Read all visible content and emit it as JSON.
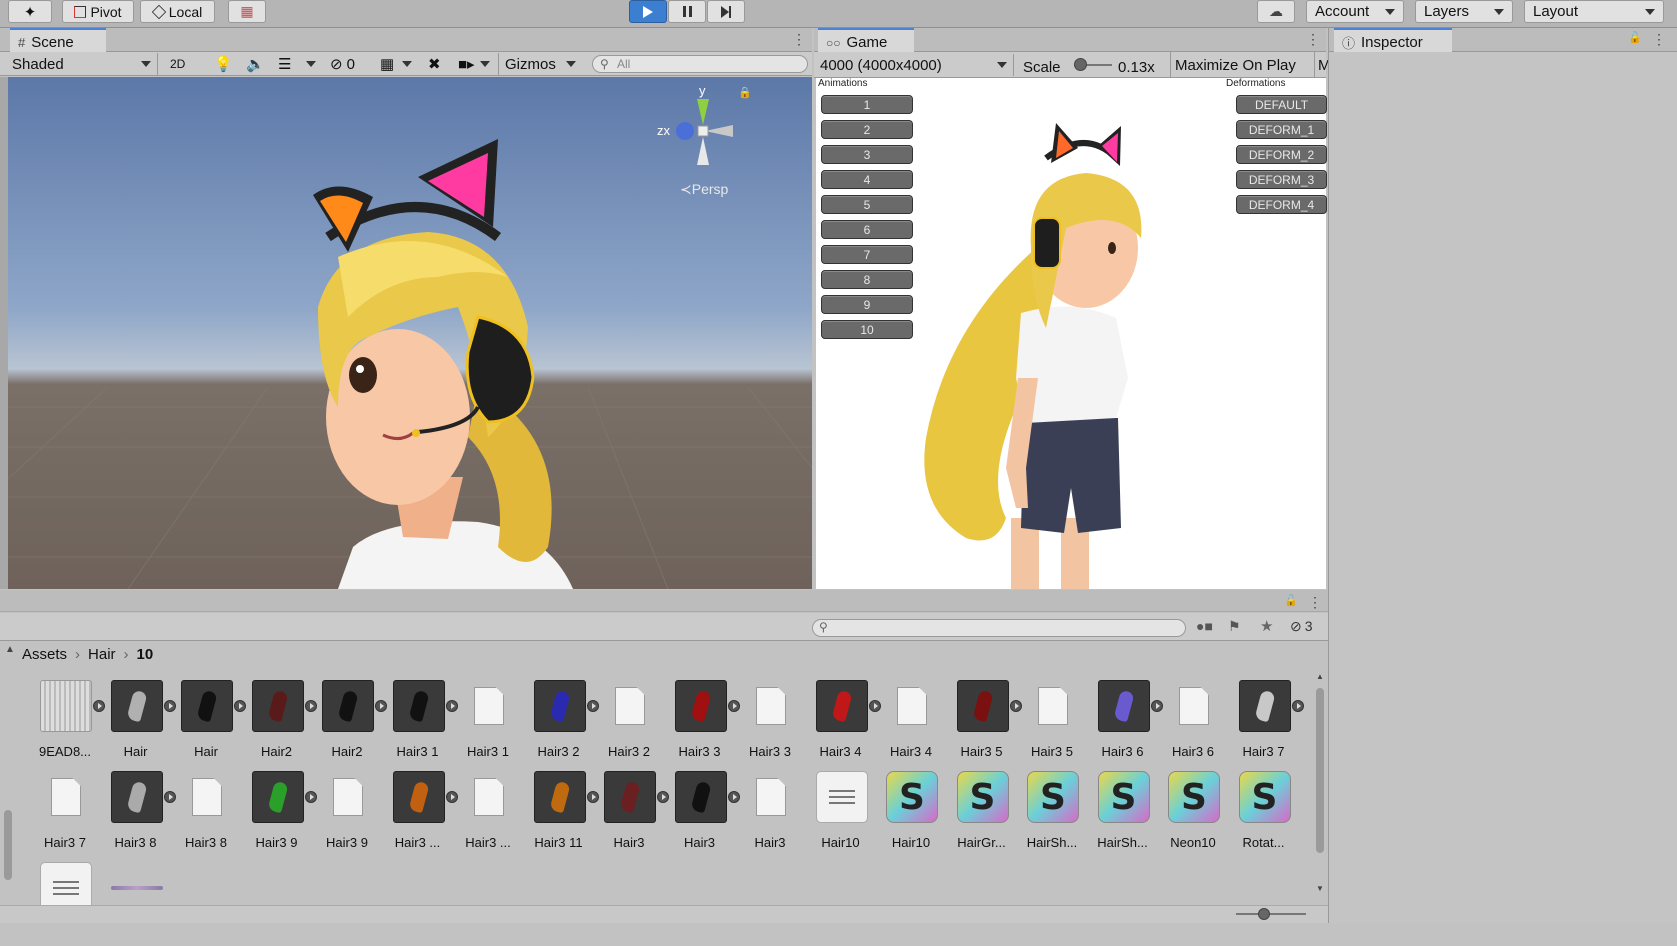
{
  "toolbar": {
    "pivot": "Pivot",
    "local": "Local",
    "account": "Account",
    "layers": "Layers",
    "layout": "Layout"
  },
  "scene": {
    "tab": "Scene",
    "shading": "Shaded",
    "mode_2d": "2D",
    "hidden_count": "0",
    "gizmos": "Gizmos",
    "search_placeholder": "All",
    "axis_y": "y",
    "axis_zx": "zx",
    "persp": "Persp"
  },
  "game": {
    "tab": "Game",
    "resolution": "4000 (4000x4000)",
    "scale_label": "Scale",
    "scale_value": "0.13x",
    "maximize": "Maximize On Play",
    "m_cut": "M",
    "animations_label": "Animations",
    "deformations_label": "Deformations",
    "animation_buttons": [
      "1",
      "2",
      "3",
      "4",
      "5",
      "6",
      "7",
      "8",
      "9",
      "10"
    ],
    "deform_buttons": [
      "DEFAULT",
      "DEFORM_1",
      "DEFORM_2",
      "DEFORM_3",
      "DEFORM_4"
    ]
  },
  "inspector": {
    "tab": "Inspector"
  },
  "project": {
    "breadcrumb": [
      "Assets",
      "Hair",
      "10"
    ],
    "hidden_count": "3",
    "assets": [
      {
        "label": "9EAD8...",
        "kind": "texture"
      },
      {
        "label": "Hair",
        "kind": "prefab",
        "color": "#b0b0b0"
      },
      {
        "label": "Hair",
        "kind": "prefab",
        "color": "#111111"
      },
      {
        "label": "Hair2",
        "kind": "prefab",
        "color": "#5a1a1a"
      },
      {
        "label": "Hair2",
        "kind": "prefab",
        "color": "#111111"
      },
      {
        "label": "Hair3 1",
        "kind": "prefab",
        "color": "#111111"
      },
      {
        "label": "Hair3 1",
        "kind": "file"
      },
      {
        "label": "Hair3 2",
        "kind": "prefab",
        "color": "#2a2ab0"
      },
      {
        "label": "Hair3 2",
        "kind": "file"
      },
      {
        "label": "Hair3 3",
        "kind": "prefab",
        "color": "#a01010"
      },
      {
        "label": "Hair3 3",
        "kind": "file"
      },
      {
        "label": "Hair3 4",
        "kind": "prefab",
        "color": "#c01818"
      },
      {
        "label": "Hair3 4",
        "kind": "file"
      },
      {
        "label": "Hair3 5",
        "kind": "prefab",
        "color": "#7a1010"
      },
      {
        "label": "Hair3 5",
        "kind": "file"
      },
      {
        "label": "Hair3 6",
        "kind": "prefab",
        "color": "#6a5ad0"
      },
      {
        "label": "Hair3 6",
        "kind": "file"
      },
      {
        "label": "Hair3 7",
        "kind": "prefab",
        "color": "#c8c8c8"
      },
      {
        "label": "Hair3 7",
        "kind": "file"
      },
      {
        "label": "Hair3 8",
        "kind": "prefab",
        "color": "#aaaaaa"
      },
      {
        "label": "Hair3 8",
        "kind": "file"
      },
      {
        "label": "Hair3 9",
        "kind": "prefab",
        "color": "#2aa02a"
      },
      {
        "label": "Hair3 9",
        "kind": "file"
      },
      {
        "label": "Hair3 ...",
        "kind": "prefab",
        "color": "#c06010"
      },
      {
        "label": "Hair3 ...",
        "kind": "file"
      },
      {
        "label": "Hair3 11",
        "kind": "prefab",
        "color": "#c06a10"
      },
      {
        "label": "Hair3",
        "kind": "prefab",
        "color": "#6a2020"
      },
      {
        "label": "Hair3",
        "kind": "prefab",
        "color": "#111111"
      },
      {
        "label": "Hair3",
        "kind": "file"
      },
      {
        "label": "Hair10",
        "kind": "text"
      },
      {
        "label": "Hair10",
        "kind": "shader"
      },
      {
        "label": "HairGr...",
        "kind": "shader"
      },
      {
        "label": "HairSh...",
        "kind": "shader"
      },
      {
        "label": "HairSh...",
        "kind": "shader"
      },
      {
        "label": "Neon10",
        "kind": "shader"
      },
      {
        "label": "Rotat...",
        "kind": "shader"
      },
      {
        "label": "",
        "kind": "text"
      },
      {
        "label": "",
        "kind": "strip"
      }
    ]
  },
  "colors": {
    "accent": "#4a83d4",
    "play_active": "#3c7ed0",
    "scene_sky_top": "#5c78a8",
    "ground": "#6e625a",
    "panel": "#c2c2c2",
    "hair_blonde": "#e8c640",
    "ear_pink": "#ff3aa0",
    "ear_orange": "#ff8a1a"
  }
}
